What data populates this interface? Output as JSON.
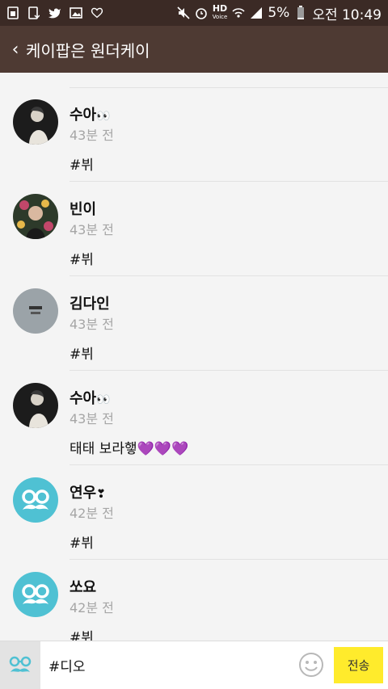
{
  "status_bar": {
    "battery": "5%",
    "time": "오전 10:49",
    "hd_label": "HD",
    "voice_label": "Voice",
    "left_icons": [
      "sim-icon",
      "mobile-data-icon",
      "twitter-icon",
      "image-icon",
      "heart-icon"
    ],
    "right_icons": [
      "mute-icon",
      "alarm-icon",
      "wifi-icon",
      "signal-icon",
      "battery-icon"
    ]
  },
  "header": {
    "back_icon": "chevron-left-icon",
    "title": "케이팝은 원더케이"
  },
  "comments": [
    {
      "name": "수아",
      "name_emoji": "👀",
      "time": "43분 전",
      "message": "#뷔",
      "avatar": "photo-dark"
    },
    {
      "name": "빈이",
      "name_emoji": "",
      "time": "43분 전",
      "message": "#뷔",
      "avatar": "photo-floral"
    },
    {
      "name": "김다인",
      "name_emoji": "",
      "time": "43분 전",
      "message": "#뷔",
      "avatar": "photo-gray"
    },
    {
      "name": "수아",
      "name_emoji": "👀",
      "time": "43분 전",
      "message": "태태 보라햏💜💜💜",
      "avatar": "photo-dark"
    },
    {
      "name": "연우",
      "name_emoji": "❣",
      "time": "42분 전",
      "message": "#뷔",
      "avatar": "default-glasses"
    },
    {
      "name": "쏘요",
      "name_emoji": "",
      "time": "42분 전",
      "message": "#뷔",
      "avatar": "default-glasses"
    }
  ],
  "composer": {
    "input_value": "#디오",
    "send_label": "전송",
    "emoji_icon": "smiley-icon",
    "profile_icon": "glasses-mustache-icon"
  },
  "colors": {
    "status_bar": "#3b2a25",
    "app_bar": "#4e3a33",
    "send_button": "#ffeb2c",
    "default_avatar": "#4fc1d3"
  }
}
